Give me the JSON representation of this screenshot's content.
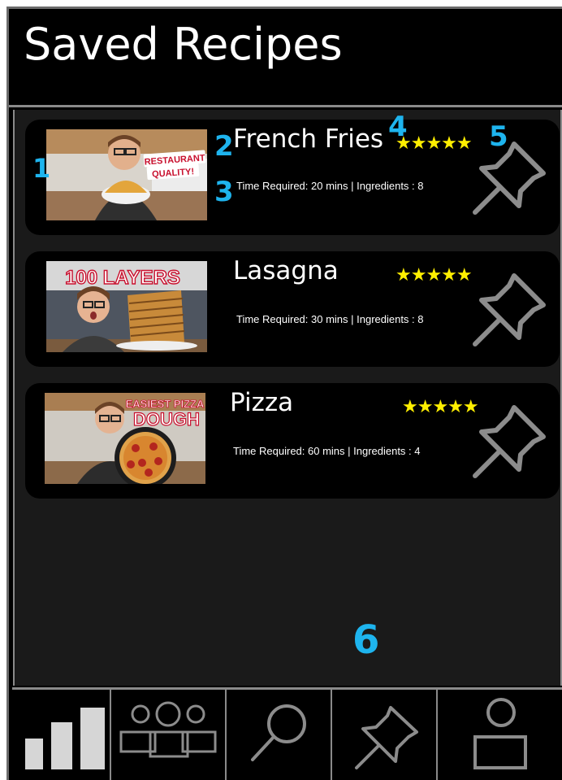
{
  "header": {
    "title": "Saved Recipes"
  },
  "recipes": [
    {
      "name": "French Fries",
      "time_label": "Time Required: 20 mins | Ingredients : 8",
      "rating": "★★★★★",
      "thumbnail": {
        "caption_line1": "RESTAURANT",
        "caption_line2": "QUALITY!"
      }
    },
    {
      "name": "Lasagna",
      "time_label": "Time Required: 30 mins | Ingredients : 8",
      "rating": "★★★★★",
      "thumbnail": {
        "caption_line1": "100 LAYERS"
      }
    },
    {
      "name": "Pizza",
      "time_label": "Time Required: 60 mins | Ingredients : 4",
      "rating": "★★★★★",
      "thumbnail": {
        "caption_line1": "EASIEST PIZZA",
        "caption_line2": "DOUGH"
      }
    }
  ],
  "annotations": [
    "1",
    "2",
    "3",
    "4",
    "5",
    "6"
  ],
  "navbar": {
    "tabs": [
      {
        "icon": "bar-chart-icon"
      },
      {
        "icon": "group-icon"
      },
      {
        "icon": "search-icon"
      },
      {
        "icon": "pin-icon"
      },
      {
        "icon": "profile-icon"
      }
    ]
  },
  "colors": {
    "background": "#000000",
    "content_bg": "#1a1a1a",
    "star": "#ffef00",
    "annotation": "#1eb4ee",
    "icon": "#8c8c8c"
  }
}
